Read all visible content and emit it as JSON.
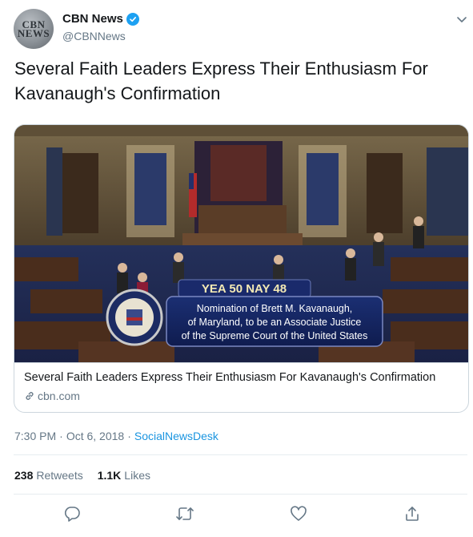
{
  "header": {
    "avatar_text": "CBN NEWS",
    "display_name": "CBN News",
    "handle": "@CBNNews"
  },
  "tweet": {
    "text": "Several Faith Leaders Express Their Enthusiasm For Kavanaugh's Confirmation"
  },
  "card": {
    "image_banner_counts": "YEA 50   NAY 48",
    "image_banner_line1": "Nomination of Brett M. Kavanaugh,",
    "image_banner_line2": "of Maryland, to be an Associate Justice",
    "image_banner_line3": "of the Supreme Court of the United States",
    "title": "Several Faith Leaders Express Their Enthusiasm For Kavanaugh's Confirmation",
    "domain": "cbn.com"
  },
  "meta": {
    "time": "7:30 PM",
    "date": "Oct 6, 2018",
    "separator": "·",
    "source": "SocialNewsDesk"
  },
  "stats": {
    "retweets_count": "238",
    "retweets_label": "Retweets",
    "likes_count": "1.1K",
    "likes_label": "Likes"
  },
  "icons": {
    "reply": "speech-bubble-icon",
    "retweet": "retweet-icon",
    "like": "heart-icon",
    "share": "share-icon",
    "verified": "verified-badge-icon",
    "menu": "chevron-down-icon",
    "link": "link-icon"
  },
  "colors": {
    "accent": "#1da1f2",
    "link": "#1b95e0",
    "muted": "#657786",
    "text": "#14171a",
    "border": "#ccd6dd"
  }
}
